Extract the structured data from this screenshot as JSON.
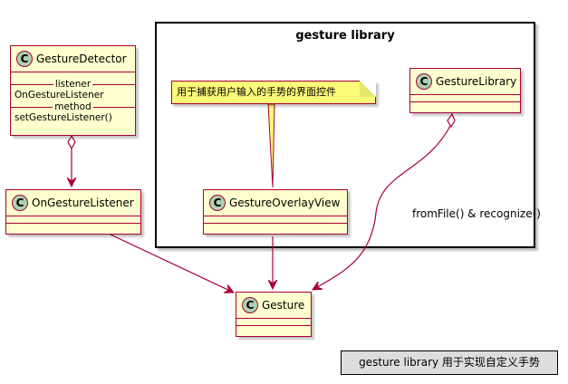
{
  "package": {
    "title": "gesture library"
  },
  "classes": {
    "gesture_detector": {
      "name": "GestureDetector",
      "badge": "C",
      "divider_listener": "listener",
      "listener_value": "OnGestureListener",
      "divider_method": "method",
      "method_value": "setGestureListener()"
    },
    "on_gesture_listener": {
      "name": "OnGestureListener",
      "badge": "C"
    },
    "gesture_library": {
      "name": "GestureLibrary",
      "badge": "C"
    },
    "gesture_overlay_view": {
      "name": "GestureOverlayView",
      "badge": "C"
    },
    "gesture": {
      "name": "Gesture",
      "badge": "C"
    }
  },
  "note": {
    "text": "用于捕获用户输入的手势的界面控件"
  },
  "edge_labels": {
    "library_to_gesture": "fromFile() & recognize()"
  },
  "legend": {
    "text": "gesture library 用于实现自定义手势"
  },
  "colors": {
    "class_fill": "#fefece",
    "class_border": "#a80036",
    "badge_fill": "#add1b2",
    "note_fill": "#fbfb77",
    "legend_fill": "#dddddd"
  }
}
